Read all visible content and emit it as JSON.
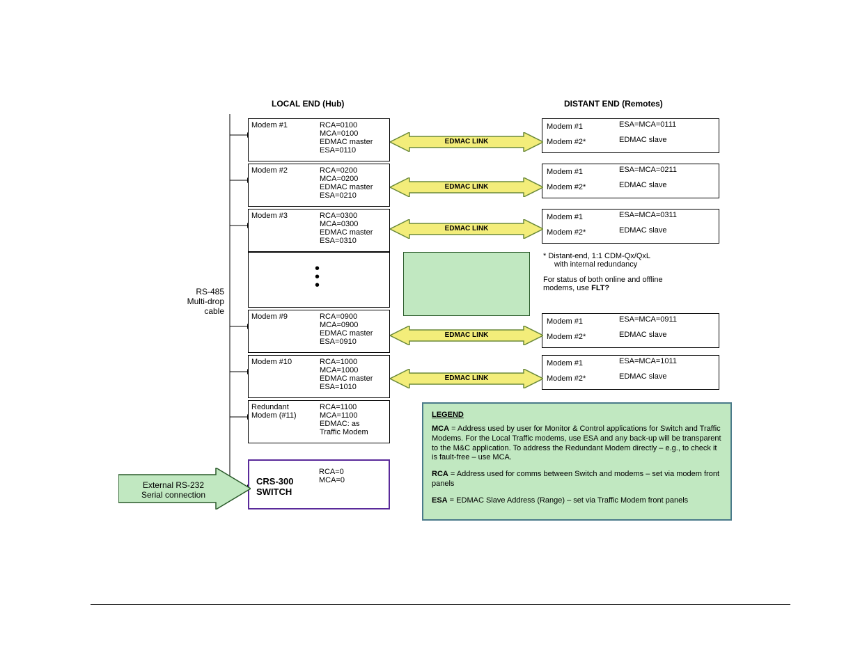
{
  "titles": {
    "local": "LOCAL END (Hub)",
    "distant": "DISTANT END (Remotes)"
  },
  "bus_label_1": "RS-485",
  "bus_label_2": "Multi-drop",
  "bus_label_3": "cable",
  "local_modems": [
    {
      "name": "Modem #1",
      "l1": "RCA=0100",
      "l2": "MCA=0100",
      "l3": "EDMAC master",
      "l4": "ESA=0110"
    },
    {
      "name": "Modem #2",
      "l1": "RCA=0200",
      "l2": "MCA=0200",
      "l3": "EDMAC master",
      "l4": "ESA=0210"
    },
    {
      "name": "Modem #3",
      "l1": "RCA=0300",
      "l2": "MCA=0300",
      "l3": "EDMAC master",
      "l4": "ESA=0310"
    },
    {
      "name": "Modem #9",
      "l1": "RCA=0900",
      "l2": "MCA=0900",
      "l3": "EDMAC master",
      "l4": "ESA=0910"
    },
    {
      "name": "Modem #10",
      "l1": "RCA=1000",
      "l2": "MCA=1000",
      "l3": "EDMAC master",
      "l4": "ESA=1010"
    },
    {
      "name": "Redundant",
      "name2": "Modem (#11)",
      "l1": "RCA=1100",
      "l2": "MCA=1100",
      "l3": "EDMAC: as",
      "l4": "Traffic Modem"
    }
  ],
  "remote_modems": [
    {
      "r1": "Modem #1",
      "v1": "ESA=MCA=0111",
      "r2": "Modem #2*",
      "v2": "EDMAC slave"
    },
    {
      "r1": "Modem #1",
      "v1": "ESA=MCA=0211",
      "r2": "Modem #2*",
      "v2": "EDMAC slave"
    },
    {
      "r1": "Modem #1",
      "v1": "ESA=MCA=0311",
      "r2": "Modem #2*",
      "v2": "EDMAC slave"
    },
    {
      "r1": "Modem #1",
      "v1": "ESA=MCA=0911",
      "r2": "Modem #2*",
      "v2": "EDMAC slave"
    },
    {
      "r1": "Modem #1",
      "v1": "ESA=MCA=1011",
      "r2": "Modem #2*",
      "v2": "EDMAC slave"
    }
  ],
  "link_label": "EDMAC LINK",
  "mid_note_1": "* Distant-end, 1:1 CDM-Qx/QxL",
  "mid_note_2": "with internal redundancy",
  "mid_note_3": "For status of both online and offline",
  "mid_note_4": "modems, use ",
  "mid_note_4b": "FLT?",
  "switch": {
    "name": "CRS-300",
    "sub": "SWITCH",
    "l1": "RCA=0",
    "l2": "MCA=0"
  },
  "ext_arrow_1": "External RS-232",
  "ext_arrow_2": "Serial connection",
  "legend": {
    "title": "LEGEND",
    "mca_b": "MCA",
    "mca": " = Address used by user for Monitor & Control applications for Switch and Traffic Modems. For the Local Traffic modems, use ESA and any back-up will be transparent to the M&C application. To address the Redundant Modem directly – e.g., to check it is fault-free – use MCA.",
    "rca_b": "RCA",
    "rca": " = Address used for comms between Switch and modems – set via modem front panels",
    "esa_b": "ESA",
    "esa": " = EDMAC Slave Address (Range) – set via Traffic Modem front panels"
  }
}
